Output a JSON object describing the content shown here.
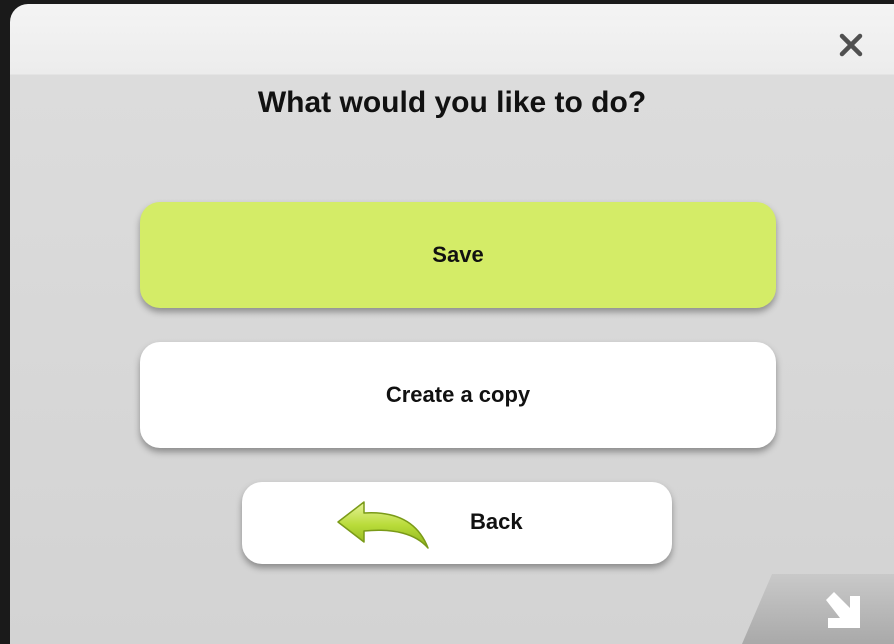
{
  "dialog": {
    "title": "What would you like to do?",
    "close_icon": "close-icon",
    "buttons": {
      "save": "Save",
      "copy": "Create a copy",
      "back": "Back"
    },
    "back_icon": "back-arrow-icon",
    "corner_icon": "arrow-down-right-icon"
  },
  "colors": {
    "save_button": "#d4ec67",
    "back_arrow": "#a9cf24"
  }
}
